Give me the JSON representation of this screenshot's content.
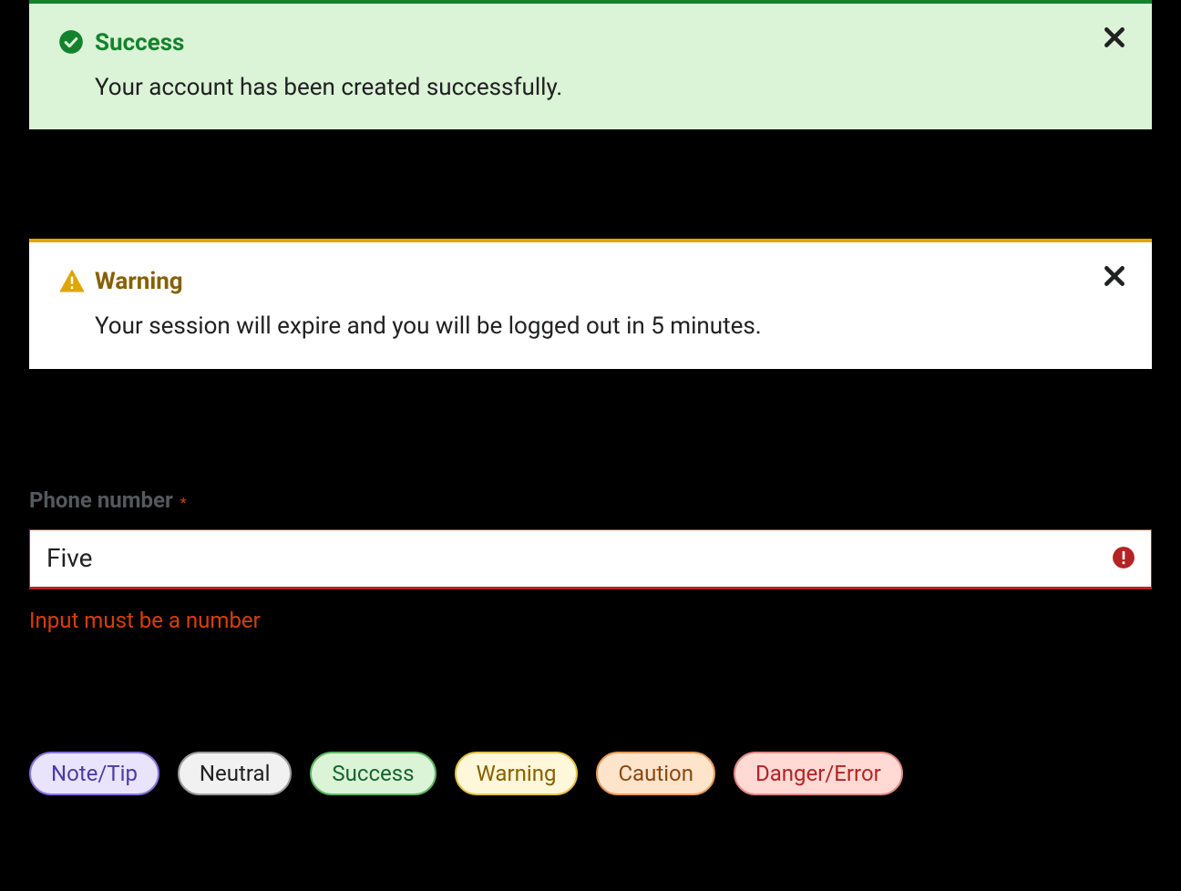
{
  "alert_success": {
    "title": "Success",
    "body": "Your account has been created successfully."
  },
  "alert_warning": {
    "title": "Warning",
    "body": "Your session will expire and you will be logged out in 5 minutes."
  },
  "field": {
    "label": "Phone number",
    "required_mark": "*",
    "value": "Five",
    "error": "Input must be a number"
  },
  "pills": {
    "note": "Note/Tip",
    "neutral": "Neutral",
    "success": "Success",
    "warning": "Warning",
    "caution": "Caution",
    "danger": "Danger/Error"
  }
}
